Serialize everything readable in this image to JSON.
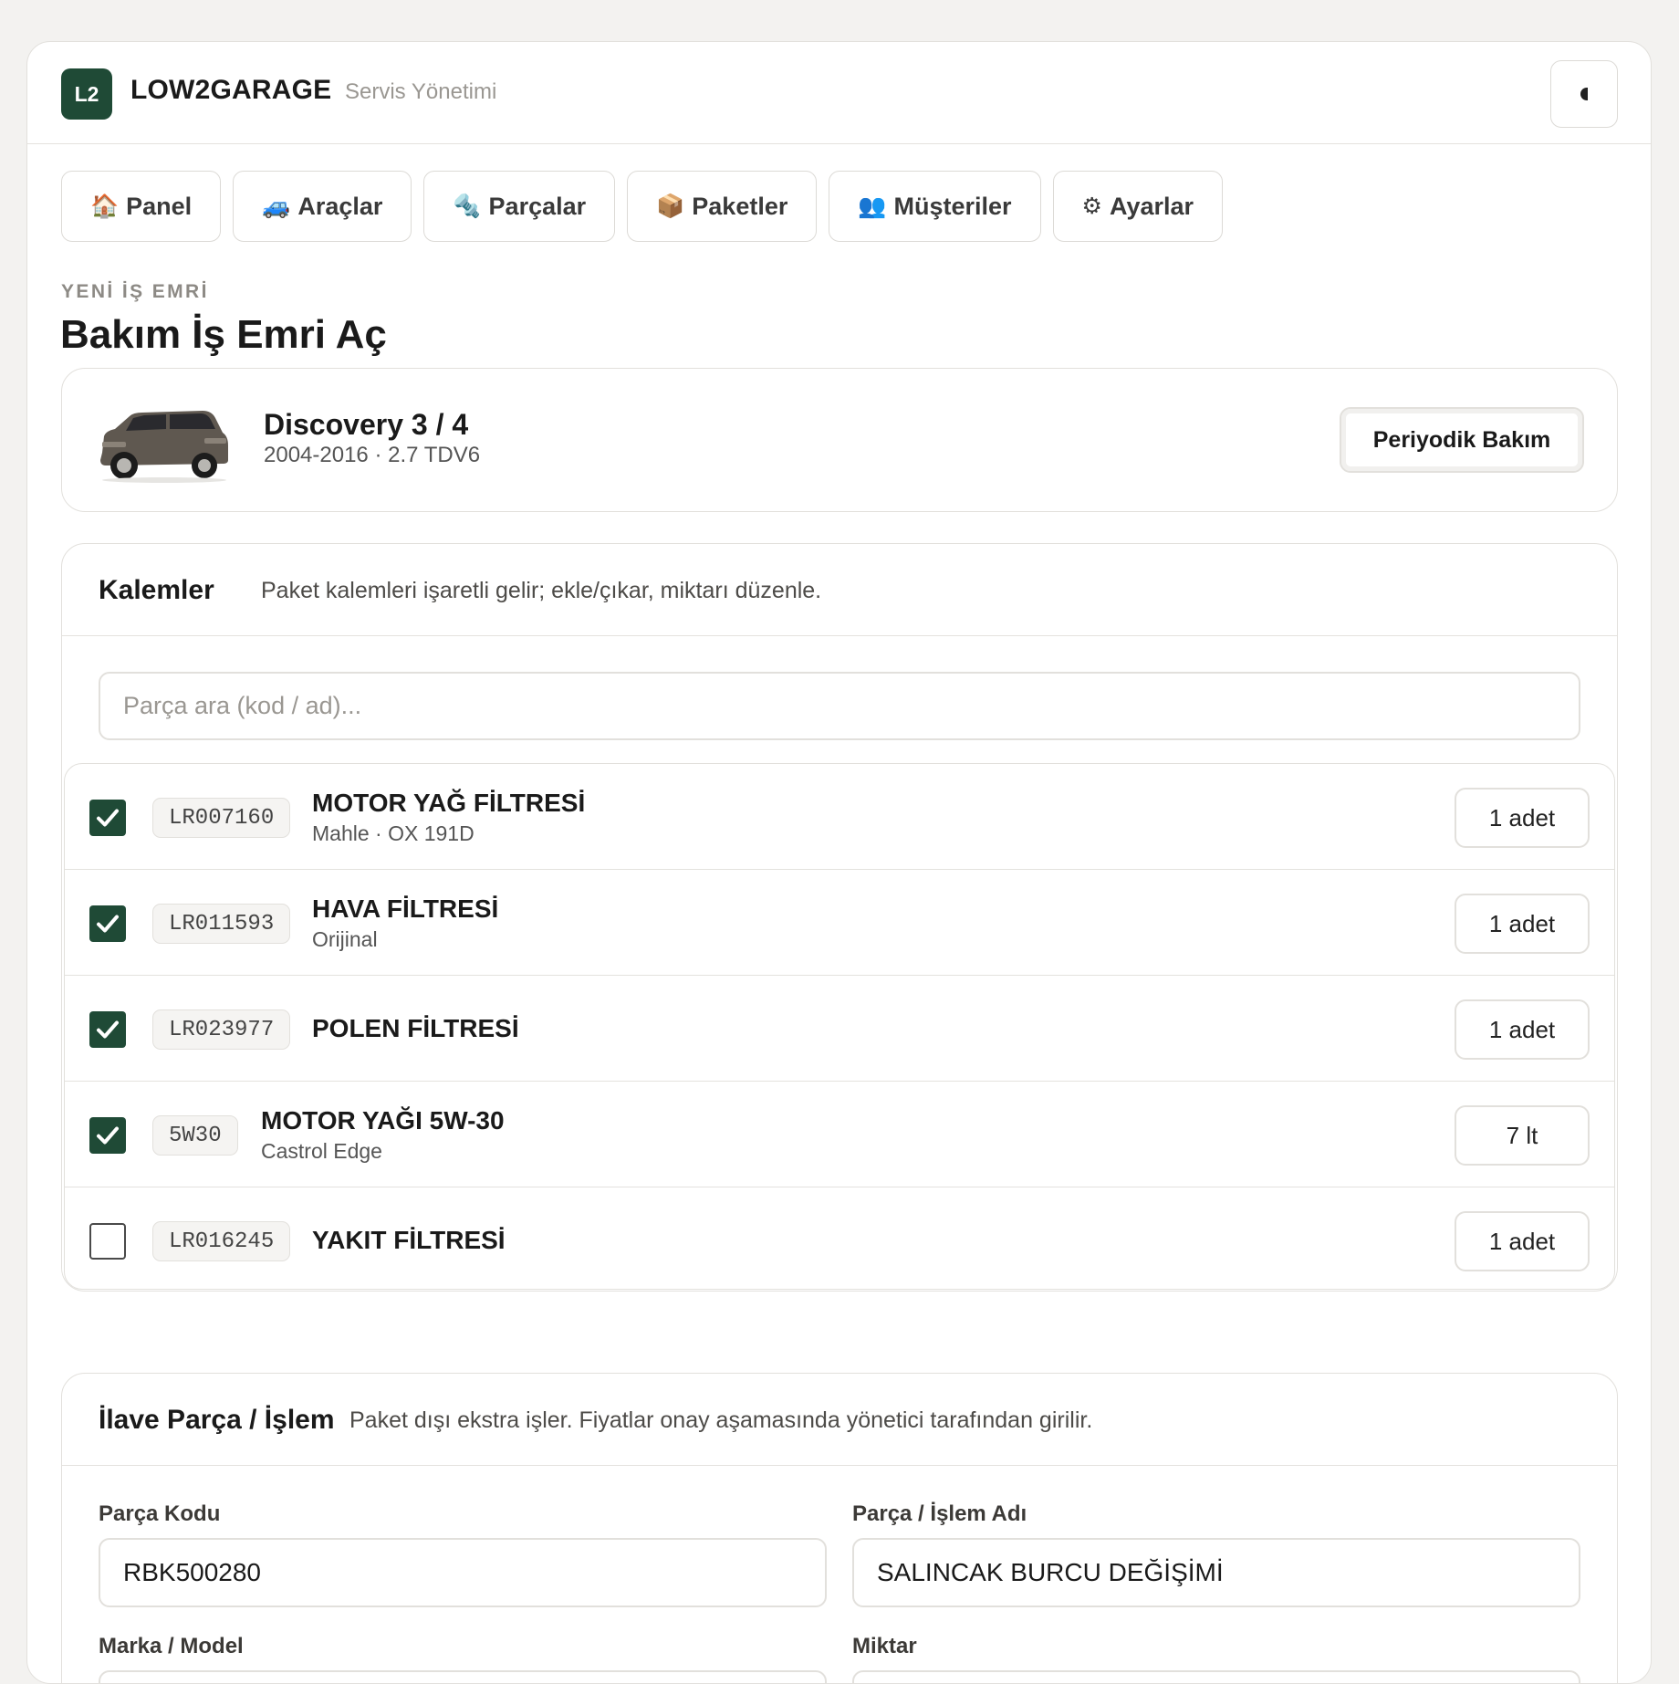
{
  "brand": {
    "logo": "L2",
    "name": "LOW2GARAGE",
    "subtitle": "Servis Yönetimi"
  },
  "nav": [
    {
      "icon": "🏠",
      "label": "Panel"
    },
    {
      "icon": "🚙",
      "label": "Araçlar"
    },
    {
      "icon": "🔩",
      "label": "Parçalar"
    },
    {
      "icon": "📦",
      "label": "Paketler"
    },
    {
      "icon": "👥",
      "label": "Müşteriler"
    },
    {
      "icon": "⚙",
      "label": "Ayarlar"
    }
  ],
  "page": {
    "eyebrow": "YENİ İŞ EMRİ",
    "title": "Bakım İş Emri Aç"
  },
  "vehicle": {
    "name": "Discovery 3 / 4",
    "details": "2004-2016 · 2.7 TDV6",
    "package_label": "Periyodik Bakım"
  },
  "items": {
    "title": "Kalemler",
    "description": "Paket kalemleri işaretli gelir; ekle/çıkar, miktarı düzenle.",
    "search_placeholder": "Parça ara (kod / ad)...",
    "rows": [
      {
        "checked": true,
        "code": "LR007160",
        "name": "MOTOR YAĞ FİLTRESİ",
        "brand": "Mahle · OX 191D",
        "qty": "1 adet"
      },
      {
        "checked": true,
        "code": "LR011593",
        "name": "HAVA FİLTRESİ",
        "brand": "Orijinal",
        "qty": "1 adet"
      },
      {
        "checked": true,
        "code": "LR023977",
        "name": "POLEN FİLTRESİ",
        "brand": "",
        "qty": "1 adet"
      },
      {
        "checked": true,
        "code": "5W30",
        "name": "MOTOR YAĞI 5W-30",
        "brand": "Castrol Edge",
        "qty": "7 lt"
      },
      {
        "checked": false,
        "code": "LR016245",
        "name": "YAKIT FİLTRESİ",
        "brand": "",
        "qty": "1 adet"
      }
    ]
  },
  "extra": {
    "title": "İlave Parça / İşlem",
    "description": "Paket dışı ekstra işler. Fiyatlar onay aşamasında yönetici tarafından girilir.",
    "part_code_label": "Parça Kodu",
    "part_code_value": "RBK500280",
    "part_name_label": "Parça / İşlem Adı",
    "part_name_value": "SALINCAK BURCU DEĞİŞİMİ",
    "brand_label": "Marka / Model",
    "qty_label": "Miktar"
  },
  "colors": {
    "accent": "#1f4a36",
    "background": "#f3f2f0",
    "border": "#e2e0dc"
  }
}
